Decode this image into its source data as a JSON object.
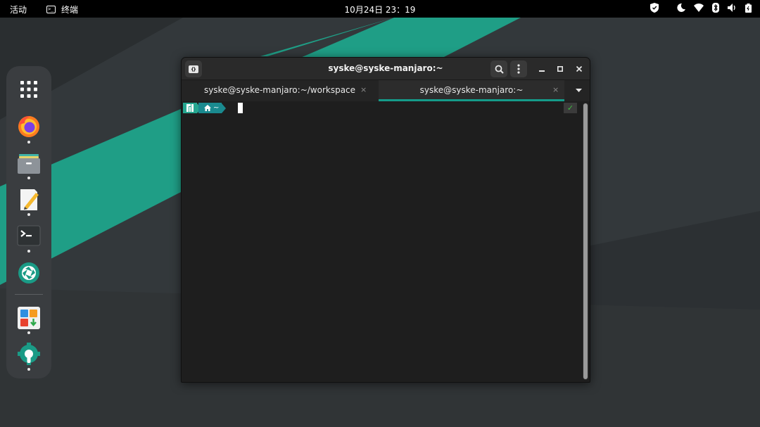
{
  "topbar": {
    "activities": "活动",
    "app_name": "终端",
    "app_icon_glyph": ">_",
    "clock": "10月24日  23：19",
    "tray_icons": [
      "shield-icon",
      "night-light-icon",
      "wifi-icon",
      "bluetooth-icon",
      "volume-icon",
      "battery-icon"
    ]
  },
  "dock": {
    "items": [
      "app-grid-icon",
      "firefox-icon",
      "files-icon",
      "text-editor-icon",
      "terminal-icon",
      "aperture-icon",
      "software-store-icon",
      "settings-icon"
    ]
  },
  "terminal": {
    "title": "syske@syske-manjaro:~",
    "tabs": [
      {
        "label": "syske@syske-manjaro:~/workspace",
        "close": "×",
        "active": false
      },
      {
        "label": "syske@syske-manjaro:~",
        "close": "×",
        "active": true
      }
    ],
    "prompt": {
      "dir_label": "~"
    },
    "status": "✓"
  },
  "colors": {
    "accent": "#159b8a",
    "topbar_bg": "#000000",
    "dock_bg": "#3a3d40",
    "terminal_bg": "#1e1e1e",
    "headerbar_bg": "#2a2a2a"
  }
}
